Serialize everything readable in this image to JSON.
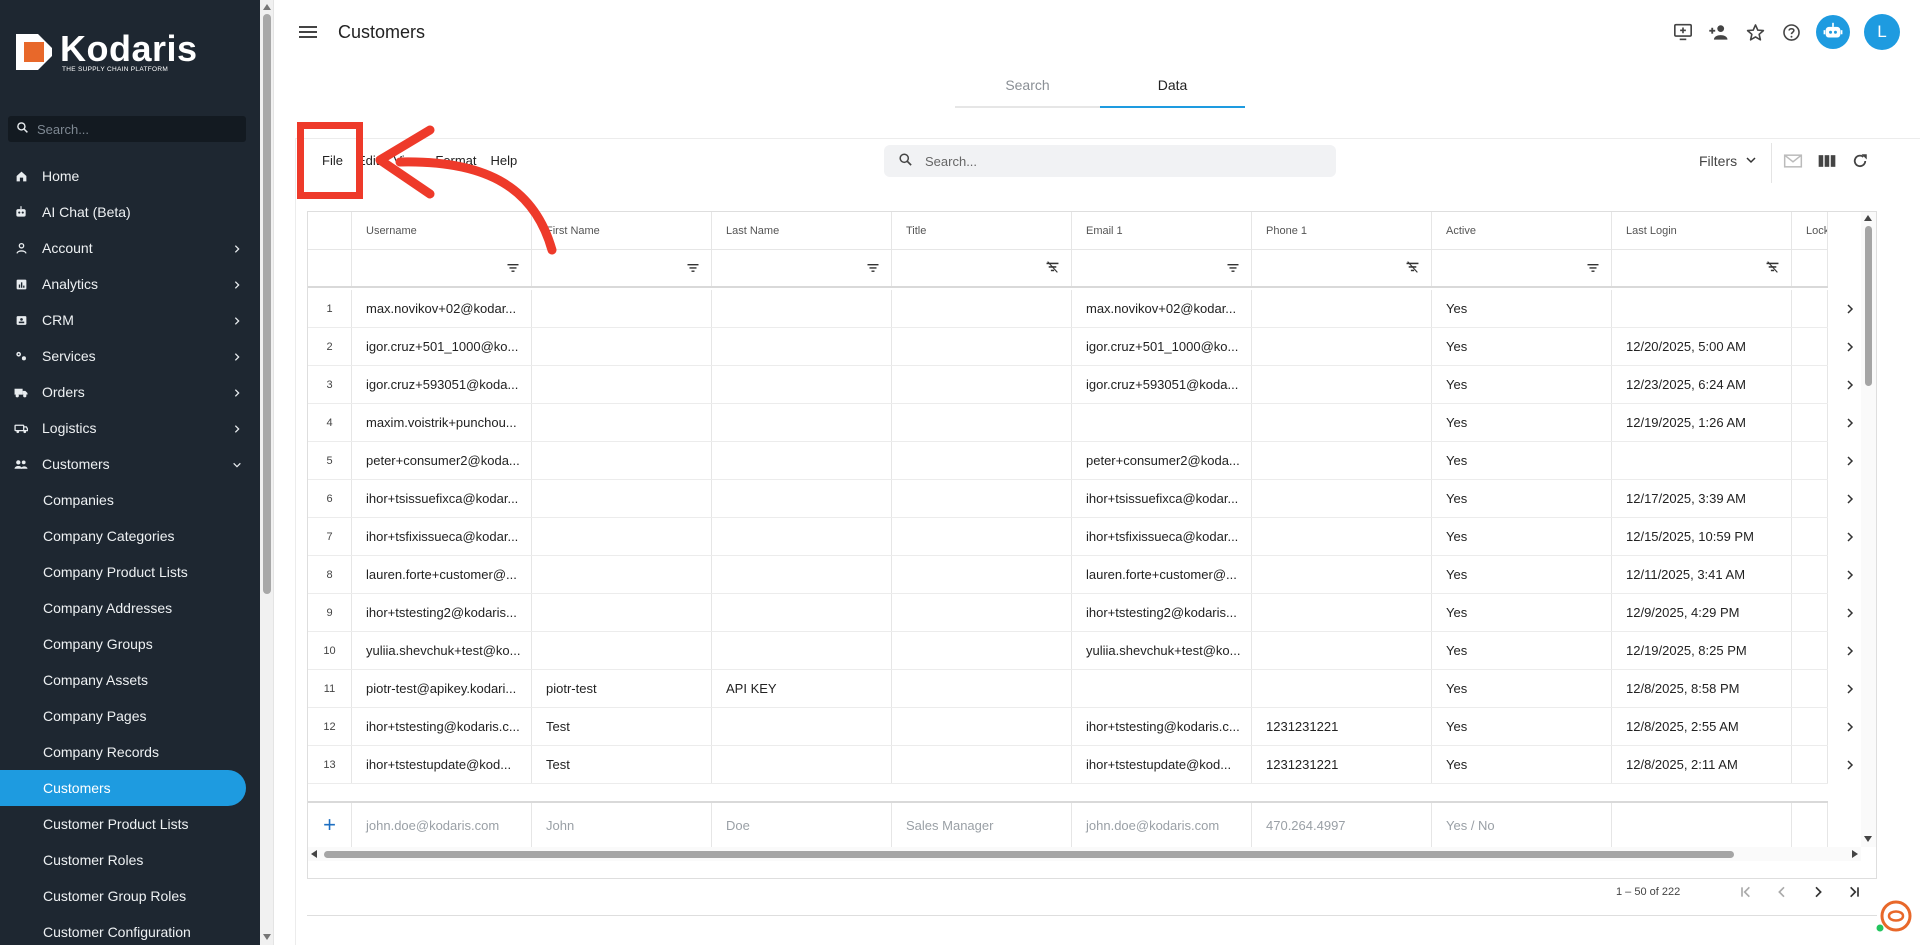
{
  "app": {
    "logo_name": "Kodaris",
    "logo_tagline": "THE SUPPLY CHAIN PLATFORM",
    "accent_color": "#1e9be0",
    "sidebar_bg": "#1e2731"
  },
  "sidebar": {
    "search_placeholder": "Search...",
    "items": [
      {
        "label": "Home",
        "icon": "home-icon"
      },
      {
        "label": "AI Chat (Beta)",
        "icon": "robot-icon"
      },
      {
        "label": "Account",
        "icon": "person-icon",
        "chevron": "right"
      },
      {
        "label": "Analytics",
        "icon": "chart-icon",
        "chevron": "right"
      },
      {
        "label": "CRM",
        "icon": "contacts-icon",
        "chevron": "right"
      },
      {
        "label": "Services",
        "icon": "services-icon",
        "chevron": "right"
      },
      {
        "label": "Orders",
        "icon": "truck-icon",
        "chevron": "right"
      },
      {
        "label": "Logistics",
        "icon": "logistics-icon",
        "chevron": "right"
      },
      {
        "label": "Customers",
        "icon": "people-icon",
        "chevron": "down"
      }
    ],
    "sub_items": [
      "Companies",
      "Company Categories",
      "Company Product Lists",
      "Company Addresses",
      "Company Groups",
      "Company Assets",
      "Company Pages",
      "Company Records",
      "Customers",
      "Customer Product Lists",
      "Customer Roles",
      "Customer Group Roles",
      "Customer Configuration"
    ],
    "active_sub_item": "Customers"
  },
  "header": {
    "title": "Customers",
    "icons": [
      "add-to-screen-icon",
      "add-person-icon",
      "star-icon",
      "help-icon",
      "ai-bot-icon"
    ],
    "avatar_letter": "L"
  },
  "tabs": [
    {
      "label": "Search",
      "active": false
    },
    {
      "label": "Data",
      "active": true
    }
  ],
  "toolbar": {
    "menus": [
      "File",
      "Edit",
      "View",
      "Format",
      "Help"
    ],
    "search_placeholder": "Search...",
    "filters_label": "Filters"
  },
  "grid": {
    "columns": [
      "Username",
      "First Name",
      "Last Name",
      "Title",
      "Email 1",
      "Phone 1",
      "Active",
      "Last Login",
      "Lock"
    ],
    "rows": [
      {
        "n": "1",
        "username": "max.novikov+02@kodar...",
        "first": "",
        "last": "",
        "title": "",
        "email": "max.novikov+02@kodar...",
        "phone": "",
        "active": "Yes",
        "login": ""
      },
      {
        "n": "2",
        "username": "igor.cruz+501_1000@ko...",
        "first": "",
        "last": "",
        "title": "",
        "email": "igor.cruz+501_1000@ko...",
        "phone": "",
        "active": "Yes",
        "login": "12/20/2025, 5:00 AM"
      },
      {
        "n": "3",
        "username": "igor.cruz+593051@koda...",
        "first": "",
        "last": "",
        "title": "",
        "email": "igor.cruz+593051@koda...",
        "phone": "",
        "active": "Yes",
        "login": "12/23/2025, 6:24 AM"
      },
      {
        "n": "4",
        "username": "maxim.voistrik+punchou...",
        "first": "",
        "last": "",
        "title": "",
        "email": "",
        "phone": "",
        "active": "Yes",
        "login": "12/19/2025, 1:26 AM"
      },
      {
        "n": "5",
        "username": "peter+consumer2@koda...",
        "first": "",
        "last": "",
        "title": "",
        "email": "peter+consumer2@koda...",
        "phone": "",
        "active": "Yes",
        "login": ""
      },
      {
        "n": "6",
        "username": "ihor+tsissuefixca@kodar...",
        "first": "",
        "last": "",
        "title": "",
        "email": "ihor+tsissuefixca@kodar...",
        "phone": "",
        "active": "Yes",
        "login": "12/17/2025, 3:39 AM"
      },
      {
        "n": "7",
        "username": "ihor+tsfixissueca@kodar...",
        "first": "",
        "last": "",
        "title": "",
        "email": "ihor+tsfixissueca@kodar...",
        "phone": "",
        "active": "Yes",
        "login": "12/15/2025, 10:59 PM"
      },
      {
        "n": "8",
        "username": "lauren.forte+customer@...",
        "first": "",
        "last": "",
        "title": "",
        "email": "lauren.forte+customer@...",
        "phone": "",
        "active": "Yes",
        "login": "12/11/2025, 3:41 AM"
      },
      {
        "n": "9",
        "username": "ihor+tstesting2@kodaris...",
        "first": "",
        "last": "",
        "title": "",
        "email": "ihor+tstesting2@kodaris...",
        "phone": "",
        "active": "Yes",
        "login": "12/9/2025, 4:29 PM"
      },
      {
        "n": "10",
        "username": "yuliia.shevchuk+test@ko...",
        "first": "",
        "last": "",
        "title": "",
        "email": "yuliia.shevchuk+test@ko...",
        "phone": "",
        "active": "Yes",
        "login": "12/19/2025, 8:25 PM"
      },
      {
        "n": "11",
        "username": "piotr-test@apikey.kodari...",
        "first": "piotr-test",
        "last": "API KEY",
        "title": "",
        "email": "",
        "phone": "",
        "active": "Yes",
        "login": "12/8/2025, 8:58 PM"
      },
      {
        "n": "12",
        "username": "ihor+tstesting@kodaris.c...",
        "first": "Test",
        "last": "",
        "title": "",
        "email": "ihor+tstesting@kodaris.c...",
        "phone": "1231231221",
        "active": "Yes",
        "login": "12/8/2025, 2:55 AM"
      },
      {
        "n": "13",
        "username": "ihor+tstestupdate@kod...",
        "first": "Test",
        "last": "",
        "title": "",
        "email": "ihor+tstestupdate@kod...",
        "phone": "1231231221",
        "active": "Yes",
        "login": "12/8/2025, 2:11 AM"
      }
    ],
    "new_row": {
      "add_symbol": "+",
      "username": "john.doe@kodaris.com",
      "first": "John",
      "last": "Doe",
      "title": "Sales Manager",
      "email": "john.doe@kodaris.com",
      "phone": "470.264.4997",
      "active": "Yes / No"
    }
  },
  "pagination": {
    "range_text": "1 – 50 of 222"
  },
  "annotation": {
    "color": "#ee3a2a"
  }
}
